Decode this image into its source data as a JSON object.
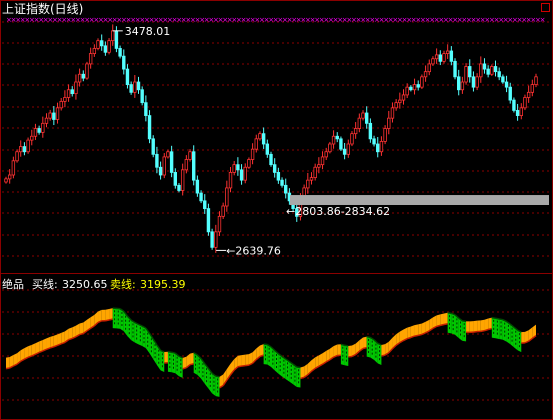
{
  "chart_title": "上证指数(日线)",
  "annotations": {
    "high": "3478.01",
    "low": "2639.76",
    "gap": "2803.86-2834.62"
  },
  "indicator": {
    "name": "绝品",
    "buy_label": "买线:",
    "buy_value": "3250.65",
    "sell_label": "卖线:",
    "sell_value": "3195.39"
  },
  "colors": {
    "background": "#000000",
    "up_candle": "#ff3232",
    "down_candle": "#54ffff",
    "frame": "#8b0000",
    "grid": "#8b0000",
    "marker_row": "#ff00ff",
    "gap_band": "#a9a9a9",
    "rise_band": "#ffa500",
    "fall_band": "#00c800",
    "sell_text": "#ffff00"
  },
  "chart_data": {
    "type": "candlestick",
    "title": "上证指数(日线)",
    "series_close": [
      2905,
      2920,
      2975,
      3010,
      3030,
      3010,
      3055,
      3070,
      3100,
      3085,
      3120,
      3140,
      3160,
      3135,
      3180,
      3205,
      3220,
      3250,
      3235,
      3280,
      3310,
      3295,
      3350,
      3390,
      3410,
      3440,
      3420,
      3395,
      3440,
      3478,
      3410,
      3380,
      3330,
      3270,
      3240,
      3280,
      3250,
      3200,
      3150,
      3060,
      3000,
      2950,
      2920,
      2990,
      3010,
      2930,
      2880,
      2860,
      2940,
      2980,
      3010,
      2900,
      2850,
      2820,
      2790,
      2700,
      2640,
      2700,
      2760,
      2800,
      2870,
      2930,
      2960,
      2940,
      2900,
      2950,
      2980,
      3020,
      3060,
      3080,
      3040,
      3000,
      2960,
      2930,
      2900,
      2880,
      2850,
      2820,
      2790,
      2760,
      2830,
      2870,
      2900,
      2910,
      2950,
      2960,
      2990,
      3010,
      3040,
      3070,
      3060,
      3020,
      3000,
      3040,
      3080,
      3100,
      3140,
      3160,
      3120,
      3060,
      3040,
      3010,
      3050,
      3100,
      3140,
      3180,
      3200,
      3210,
      3230,
      3260,
      3250,
      3270,
      3260,
      3300,
      3320,
      3350,
      3370,
      3385,
      3360,
      3390,
      3400,
      3360,
      3300,
      3250,
      3280,
      3340,
      3300,
      3260,
      3300,
      3350,
      3330,
      3310,
      3340,
      3320,
      3300,
      3280,
      3260,
      3210,
      3170,
      3150,
      3180,
      3220,
      3240,
      3270,
      3300
    ],
    "y_range": [
      2560,
      3520
    ],
    "markers": [
      {
        "text": "3478.01",
        "value": 3478.01
      },
      {
        "text": "2639.76",
        "value": 2639.76
      },
      {
        "text": "2803.86-2834.62",
        "low": 2803.86,
        "high": 2834.62
      }
    ],
    "indicator": {
      "name": "绝品",
      "buy_line": 3250.65,
      "sell_line": 3195.39
    }
  }
}
